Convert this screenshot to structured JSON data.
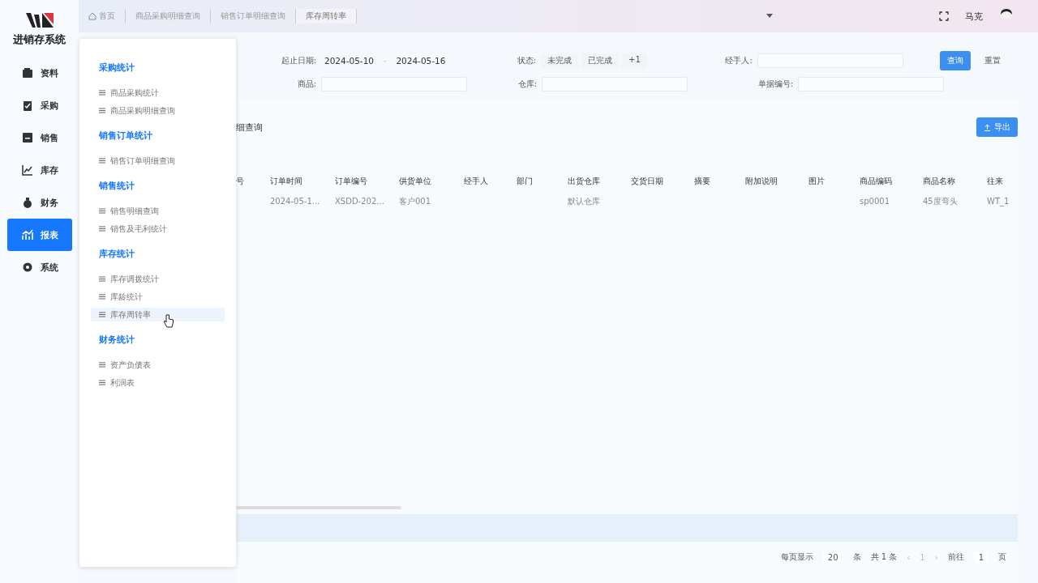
{
  "app": {
    "name": "进销存系统"
  },
  "sidebar": {
    "items": [
      {
        "label": "资料",
        "selected": false
      },
      {
        "label": "采购",
        "selected": false
      },
      {
        "label": "销售",
        "selected": false
      },
      {
        "label": "库存",
        "selected": false
      },
      {
        "label": "财务",
        "selected": false
      },
      {
        "label": "报表",
        "selected": true
      },
      {
        "label": "系统",
        "selected": false
      }
    ]
  },
  "tabs": [
    {
      "label": "首页",
      "selected": false
    },
    {
      "label": "商品采购明细查询",
      "selected": false
    },
    {
      "label": "销售订单明细查询",
      "selected": false
    },
    {
      "label": "库存周转率",
      "selected": true
    }
  ],
  "user": {
    "name": "马克"
  },
  "filters": {
    "date_label": "起止日期:",
    "date_from": "2024-05-10",
    "date_to": "2024-05-16",
    "date_sep": "·",
    "product_label": "商品:",
    "status_label": "状态:",
    "status_tags": [
      "未完成",
      "已完成",
      "+1"
    ],
    "warehouse_label": "仓库:",
    "handler_label": "经手人:",
    "doc_label": "单据编号:",
    "query": "查询",
    "reset": "重置"
  },
  "section_title": "细查询",
  "export": "导出",
  "table": {
    "columns": [
      "号",
      "订单时间",
      "订单编号",
      "供货单位",
      "经手人",
      "部门",
      "出货仓库",
      "交货日期",
      "摘要",
      "附加说明",
      "图片",
      "商品编码",
      "商品名称",
      "往来"
    ],
    "rows": [
      [
        "",
        "2024-05-1...",
        "XSDD-202...",
        "客户001",
        "",
        "",
        "默认仓库",
        "",
        "",
        "",
        "",
        "sp0001",
        "45度弯头",
        "WT_1"
      ]
    ]
  },
  "pagination": {
    "per_page_label": "每页显示",
    "per_page": "20",
    "unit": "条",
    "total": "共 1 条",
    "prev": "‹",
    "page": "1",
    "next": "›",
    "goto_label": "前往",
    "goto_page": "1",
    "page_unit": "页"
  },
  "menu": {
    "groups": [
      {
        "title": "采购统计",
        "items": [
          {
            "label": "商品采购统计",
            "hovered": false
          },
          {
            "label": "商品采购明细查询",
            "hovered": false
          }
        ]
      },
      {
        "title": "销售订单统计",
        "items": [
          {
            "label": "销售订单明细查询",
            "hovered": false
          }
        ]
      },
      {
        "title": "销售统计",
        "items": [
          {
            "label": "销售明细查询",
            "hovered": false
          },
          {
            "label": "销售及毛利统计",
            "hovered": false
          }
        ]
      },
      {
        "title": "库存统计",
        "items": [
          {
            "label": "库存调拨统计",
            "hovered": false
          },
          {
            "label": "库龄统计",
            "hovered": false
          },
          {
            "label": "库存周转率",
            "hovered": true
          }
        ]
      },
      {
        "title": "财务统计",
        "items": [
          {
            "label": "资产负债表",
            "hovered": false
          },
          {
            "label": "利润表",
            "hovered": false
          }
        ]
      }
    ]
  }
}
